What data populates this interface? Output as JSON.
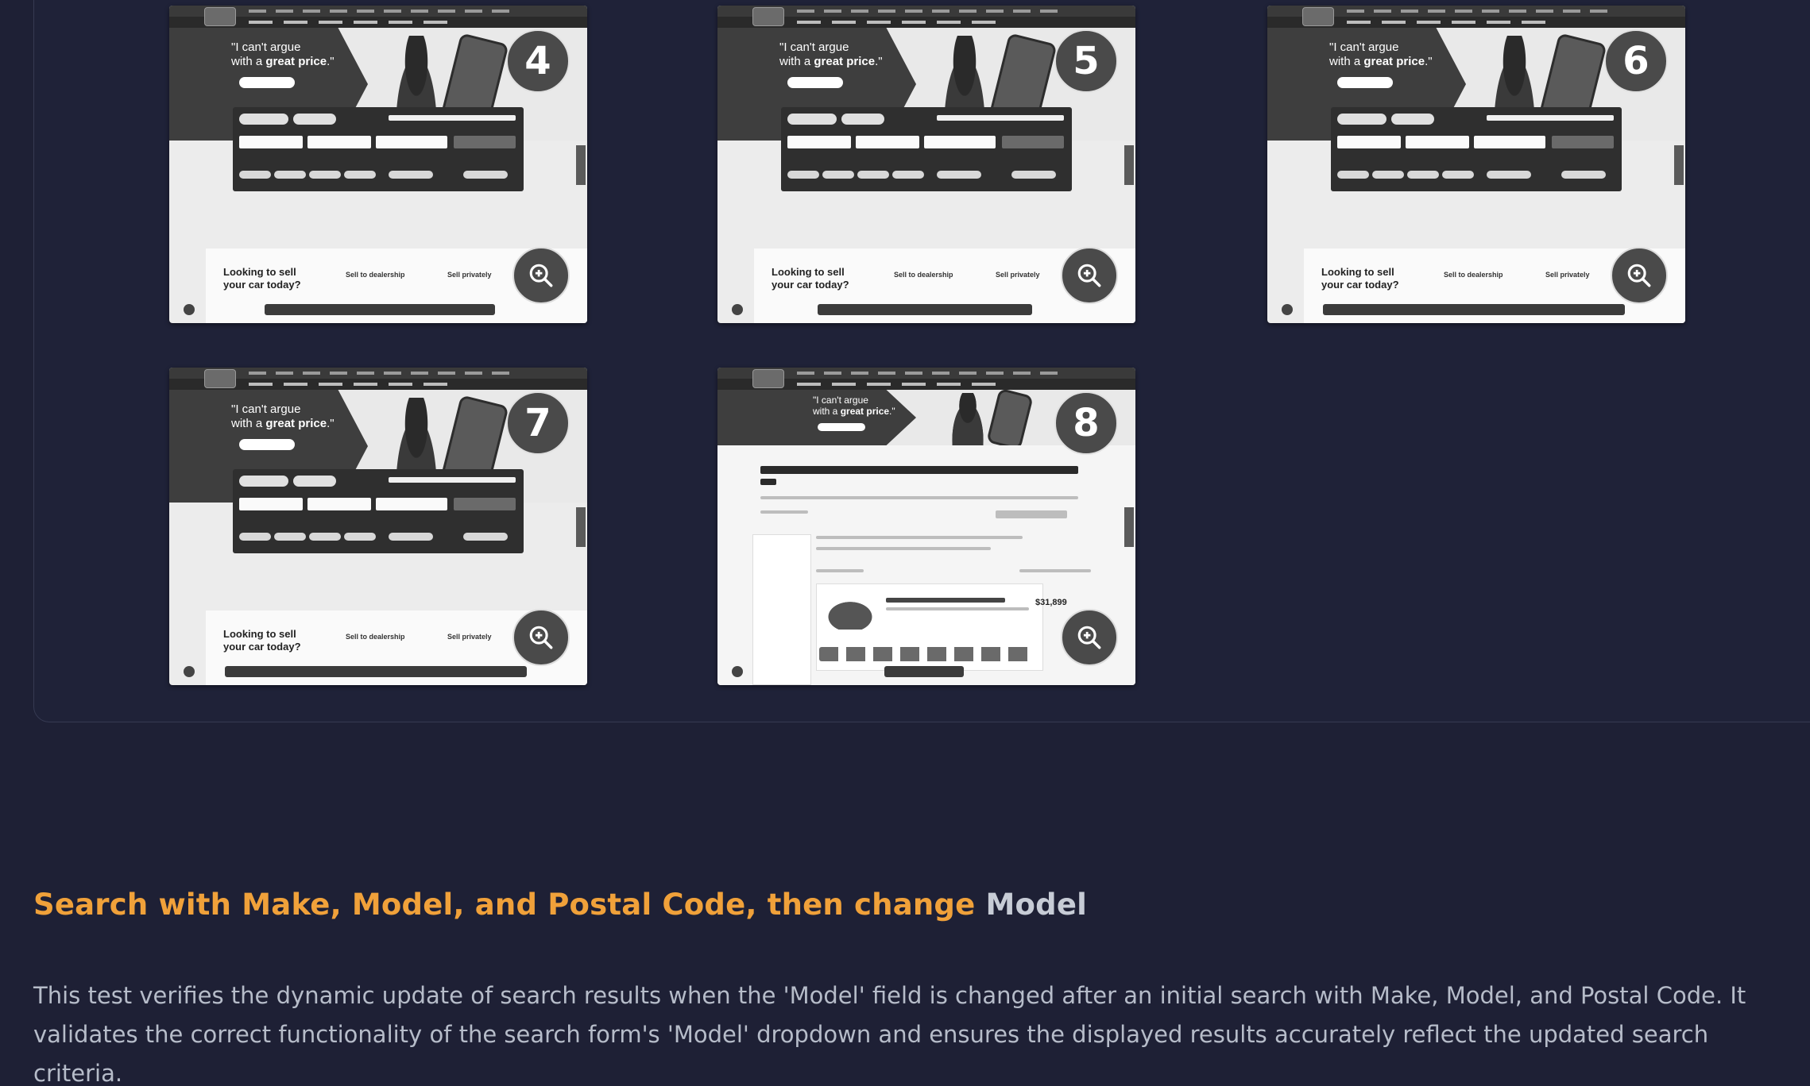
{
  "colors": {
    "background": "#1e2035",
    "title_accent": "#f0a13a",
    "title_muted": "#c7ccd6",
    "body_text": "#b6bcc9"
  },
  "thumbnails": [
    {
      "step": "4",
      "quote_line1": "\"I can't argue",
      "quote_line2_pre": "with a ",
      "quote_line2_bold": "great price",
      "quote_line2_post": ".\"",
      "sell_line1": "Looking to sell",
      "sell_line2": "your car today?",
      "option1": "Sell to dealership",
      "option2": "Sell privately",
      "icon": "zoom-in-icon"
    },
    {
      "step": "5",
      "quote_line1": "\"I can't argue",
      "quote_line2_pre": "with a ",
      "quote_line2_bold": "great price",
      "quote_line2_post": ".\"",
      "sell_line1": "Looking to sell",
      "sell_line2": "your car today?",
      "option1": "Sell to dealership",
      "option2": "Sell privately",
      "icon": "zoom-in-icon"
    },
    {
      "step": "6",
      "quote_line1": "\"I can't argue",
      "quote_line2_pre": "with a ",
      "quote_line2_bold": "great price",
      "quote_line2_post": ".\"",
      "sell_line1": "Looking to sell",
      "sell_line2": "your car today?",
      "option1": "Sell to dealership",
      "option2": "Sell privately",
      "icon": "zoom-in-icon"
    },
    {
      "step": "7",
      "quote_line1": "\"I can't argue",
      "quote_line2_pre": "with a ",
      "quote_line2_bold": "great price",
      "quote_line2_post": ".\"",
      "sell_line1": "Looking to sell",
      "sell_line2": "your car today?",
      "option1": "Sell to dealership",
      "option2": "Sell privately",
      "icon": "zoom-in-icon"
    },
    {
      "step": "8",
      "quote_line1": "\"I can't argue",
      "quote_line2_pre": "with a ",
      "quote_line2_bold": "great price",
      "quote_line2_post": ".\"",
      "price": "$31,899",
      "icon": "zoom-in-icon"
    }
  ],
  "section": {
    "title_accent": "Search with Make, Model, and Postal Code, then change",
    "title_muted": "Model",
    "description": "This test verifies the dynamic update of search results when the 'Model' field is changed after an initial search with Make, Model, and Postal Code. It validates the correct functionality of the search form's 'Model' dropdown and ensures the displayed results accurately reflect the updated search criteria."
  }
}
